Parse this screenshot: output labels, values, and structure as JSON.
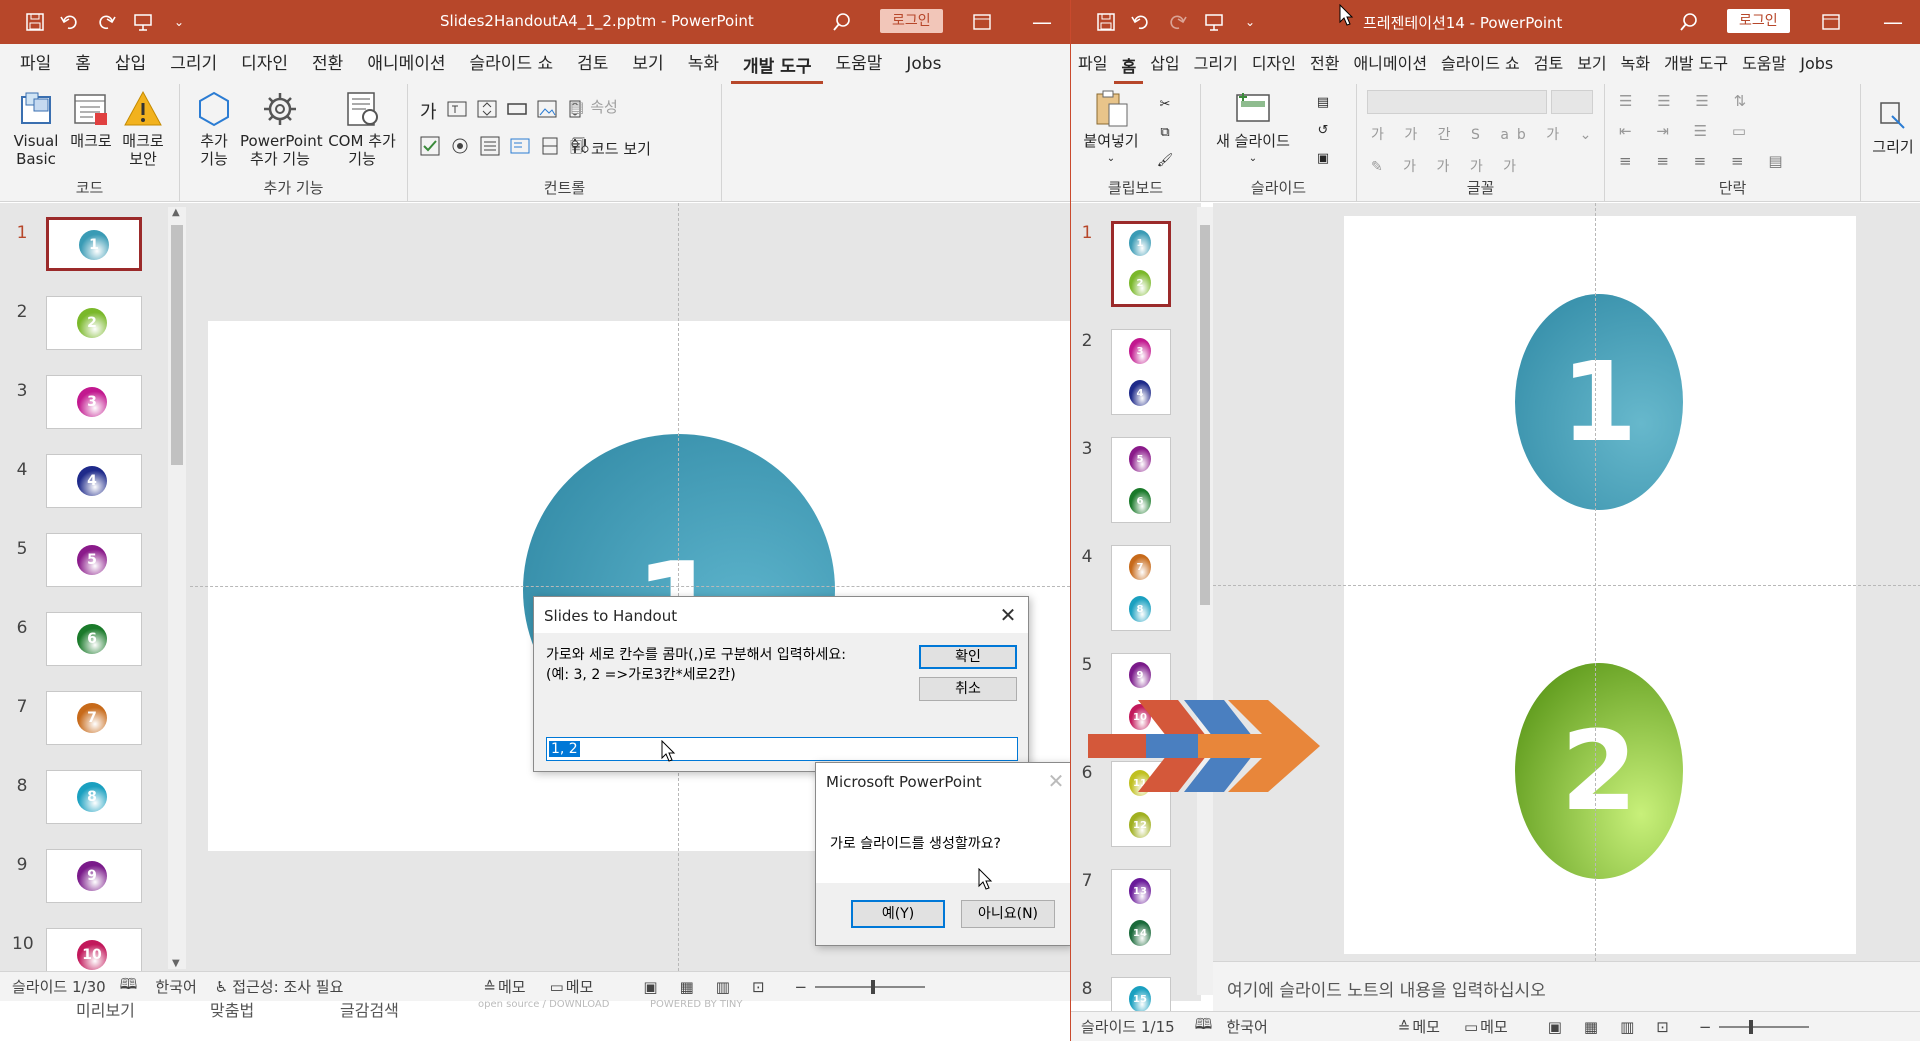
{
  "left_window": {
    "title": "Slides2HandoutA4_1_2.pptm  -  PowerPoint",
    "login": "로그인",
    "tabs": [
      "파일",
      "홈",
      "삽입",
      "그리기",
      "디자인",
      "전환",
      "애니메이션",
      "슬라이드 쇼",
      "검토",
      "보기",
      "녹화",
      "개발 도구",
      "도움말",
      "Jobs"
    ],
    "active_tab": "개발 도구",
    "ribbon": {
      "code_group": "코드",
      "visual_basic": "Visual Basic",
      "macro": "매크로",
      "macro_security": "매크로 보안",
      "addins_group": "추가 기능",
      "addins": "추가 기능",
      "ppt_addins": "PowerPoint 추가 기능",
      "com_addins": "COM 추가 기능",
      "controls_group": "컨트롤",
      "properties": "속성",
      "view_code": "코드 보기"
    },
    "slide_numbers": [
      "1",
      "2",
      "3",
      "4",
      "5",
      "6",
      "7",
      "8",
      "9",
      "10"
    ],
    "thumb_colors": [
      "#3a9bb5",
      "#7ab82a",
      "#c2188f",
      "#1e2a8a",
      "#8a1a8a",
      "#1a7a2a",
      "#c76a1a",
      "#1aa0c0",
      "#7a1a8a",
      "#c2185b"
    ],
    "main_slide_number": "1",
    "status": {
      "slide": "슬라이드 1/30",
      "language": "한국어",
      "accessibility": "접근성: 조사 필요",
      "notes": "메모",
      "comments": "메모"
    },
    "behind_text": [
      "미리보기",
      "맞춤법",
      "글감검색",
      "open source / DOWNLOAD",
      "POWERED BY TINY"
    ]
  },
  "dialog_handout": {
    "title": "Slides to Handout",
    "prompt_line1": "가로와 세로 칸수를 콤마(,)로 구분해서 입력하세요:",
    "prompt_line2": "(예: 3, 2 =>가로3칸*세로2칸)",
    "ok": "확인",
    "cancel": "취소",
    "input_value": "1, 2"
  },
  "dialog_confirm": {
    "title": "Microsoft PowerPoint",
    "message": "가로 슬라이드를 생성할까요?",
    "yes": "예(Y)",
    "no": "아니요(N)"
  },
  "right_window": {
    "title": "프레젠테이션14  -  PowerPoint",
    "login": "로그인",
    "tabs": [
      "파일",
      "홈",
      "삽입",
      "그리기",
      "디자인",
      "전환",
      "애니메이션",
      "슬라이드 쇼",
      "검토",
      "보기",
      "녹화",
      "개발 도구",
      "도움말",
      "Jobs"
    ],
    "active_tab": "홈",
    "ribbon": {
      "paste": "붙여넣기",
      "clipboard_group": "클립보드",
      "new_slide": "새 슬라이드",
      "slides_group": "슬라이드",
      "font_group": "글꼴",
      "paragraph_group": "단락",
      "draw": "그리기"
    },
    "slide_numbers": [
      "1",
      "2",
      "3",
      "4",
      "5",
      "6",
      "7",
      "8"
    ],
    "thumb_pairs": [
      [
        "1",
        "2"
      ],
      [
        "3",
        "4"
      ],
      [
        "5",
        "6"
      ],
      [
        "7",
        "8"
      ],
      [
        "9",
        "10"
      ],
      [
        "11",
        "12"
      ],
      [
        "13",
        "14"
      ],
      [
        "15",
        ""
      ]
    ],
    "pair_colors": [
      [
        "#3a9bb5",
        "#7ab82a"
      ],
      [
        "#c2188f",
        "#1e2a8a"
      ],
      [
        "#8a1a8a",
        "#1a7a2a"
      ],
      [
        "#c76a1a",
        "#1aa0c0"
      ],
      [
        "#7a1a8a",
        "#c2185b"
      ],
      [
        "#c0c020",
        "#a0b020"
      ],
      [
        "#6a1a9a",
        "#1a6a3a"
      ],
      [
        "#1aa0c0",
        ""
      ]
    ],
    "main_top": "1",
    "main_bottom": "2",
    "notes_placeholder": "여기에 슬라이드 노트의 내용을 입력하십시오",
    "status": {
      "slide": "슬라이드 1/15",
      "language": "한국어",
      "notes": "메모",
      "comments": "메모"
    }
  },
  "colors": {
    "ppt_red": "#b7472a",
    "teal": "#3a9bb5",
    "green": "#5a9a10"
  }
}
